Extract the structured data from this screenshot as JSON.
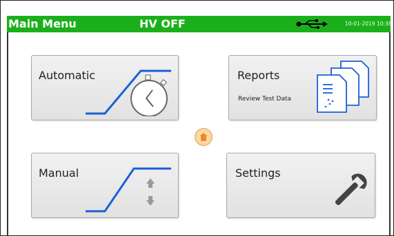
{
  "header": {
    "title": "Main Menu",
    "hv_status": "HV OFF",
    "usb_icon": "usb-icon",
    "datetime": "10-01-2019 10:38",
    "bg_color": "#1bb01b"
  },
  "tiles": {
    "automatic": {
      "label": "Automatic",
      "icon": "stopwatch-ramp-icon"
    },
    "reports": {
      "label": "Reports",
      "subtitle": "Review Test Data",
      "icon": "documents-icon"
    },
    "manual": {
      "label": "Manual",
      "icon": "ramp-arrows-icon"
    },
    "settings": {
      "label": "Settings",
      "icon": "wrench-icon"
    }
  },
  "home": {
    "icon": "home-icon",
    "color": "#f5a623"
  },
  "accent_color": "#1a5fd6"
}
